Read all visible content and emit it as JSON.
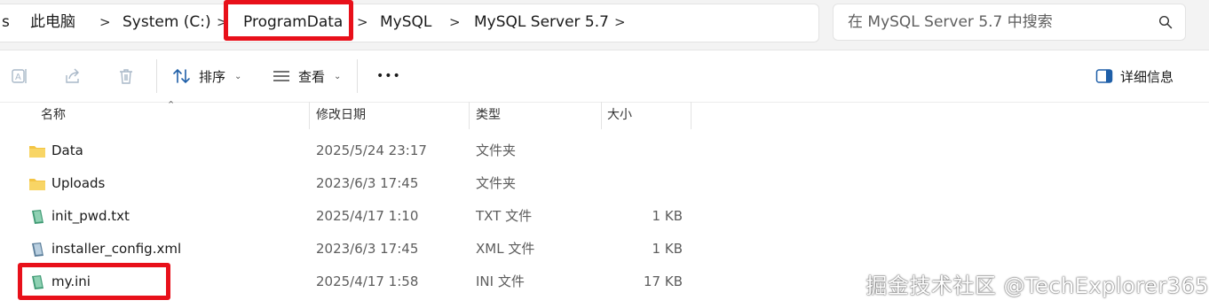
{
  "address": {
    "breadcrumbs": [
      "此电脑",
      "System (C:)",
      "ProgramData",
      "MySQL",
      "MySQL Server 5.7"
    ],
    "separator": ">",
    "leading_glyph": "s"
  },
  "search": {
    "placeholder": "在 MySQL Server 5.7 中搜索"
  },
  "toolbar": {
    "sort_label": "排序",
    "view_label": "查看",
    "more_label": "•••",
    "details_label": "详细信息"
  },
  "columns": [
    "名称",
    "修改日期",
    "类型",
    "大小"
  ],
  "files": [
    {
      "name": "Data",
      "modified": "2025/5/24 23:17",
      "type": "文件夹",
      "size": "",
      "icon": "folder-icon"
    },
    {
      "name": "Uploads",
      "modified": "2023/6/3 17:45",
      "type": "文件夹",
      "size": "",
      "icon": "folder-icon"
    },
    {
      "name": "init_pwd.txt",
      "modified": "2025/4/17 1:10",
      "type": "TXT 文件",
      "size": "1 KB",
      "icon": "text-file-icon"
    },
    {
      "name": "installer_config.xml",
      "modified": "2023/6/3 17:45",
      "type": "XML 文件",
      "size": "1 KB",
      "icon": "xml-file-icon"
    },
    {
      "name": "my.ini",
      "modified": "2025/4/17 1:58",
      "type": "INI 文件",
      "size": "17 KB",
      "icon": "config-file-icon"
    }
  ],
  "watermark": "掘金技术社区 @TechExplorer365",
  "colors": {
    "highlight": "#e8101a",
    "folder": "#f3c443",
    "text_file": "#3f9a74"
  }
}
